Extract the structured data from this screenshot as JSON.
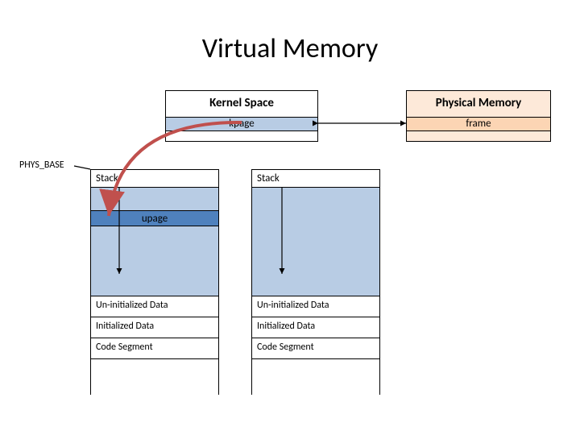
{
  "title": "Virtual Memory",
  "kernel": {
    "label": "Kernel Space",
    "kpage": "kpage"
  },
  "physical": {
    "label": "Physical Memory",
    "frame": "frame"
  },
  "phys_base": "PHYS_BASE",
  "columns": {
    "left": {
      "header": "Stack",
      "upage": "upage",
      "uninit": "Un-initialized Data",
      "init": "Initialized Data",
      "code": "Code Segment"
    },
    "right": {
      "header": "Stack",
      "uninit": "Un-initialized Data",
      "init": "Initialized Data",
      "code": "Code Segment"
    }
  }
}
